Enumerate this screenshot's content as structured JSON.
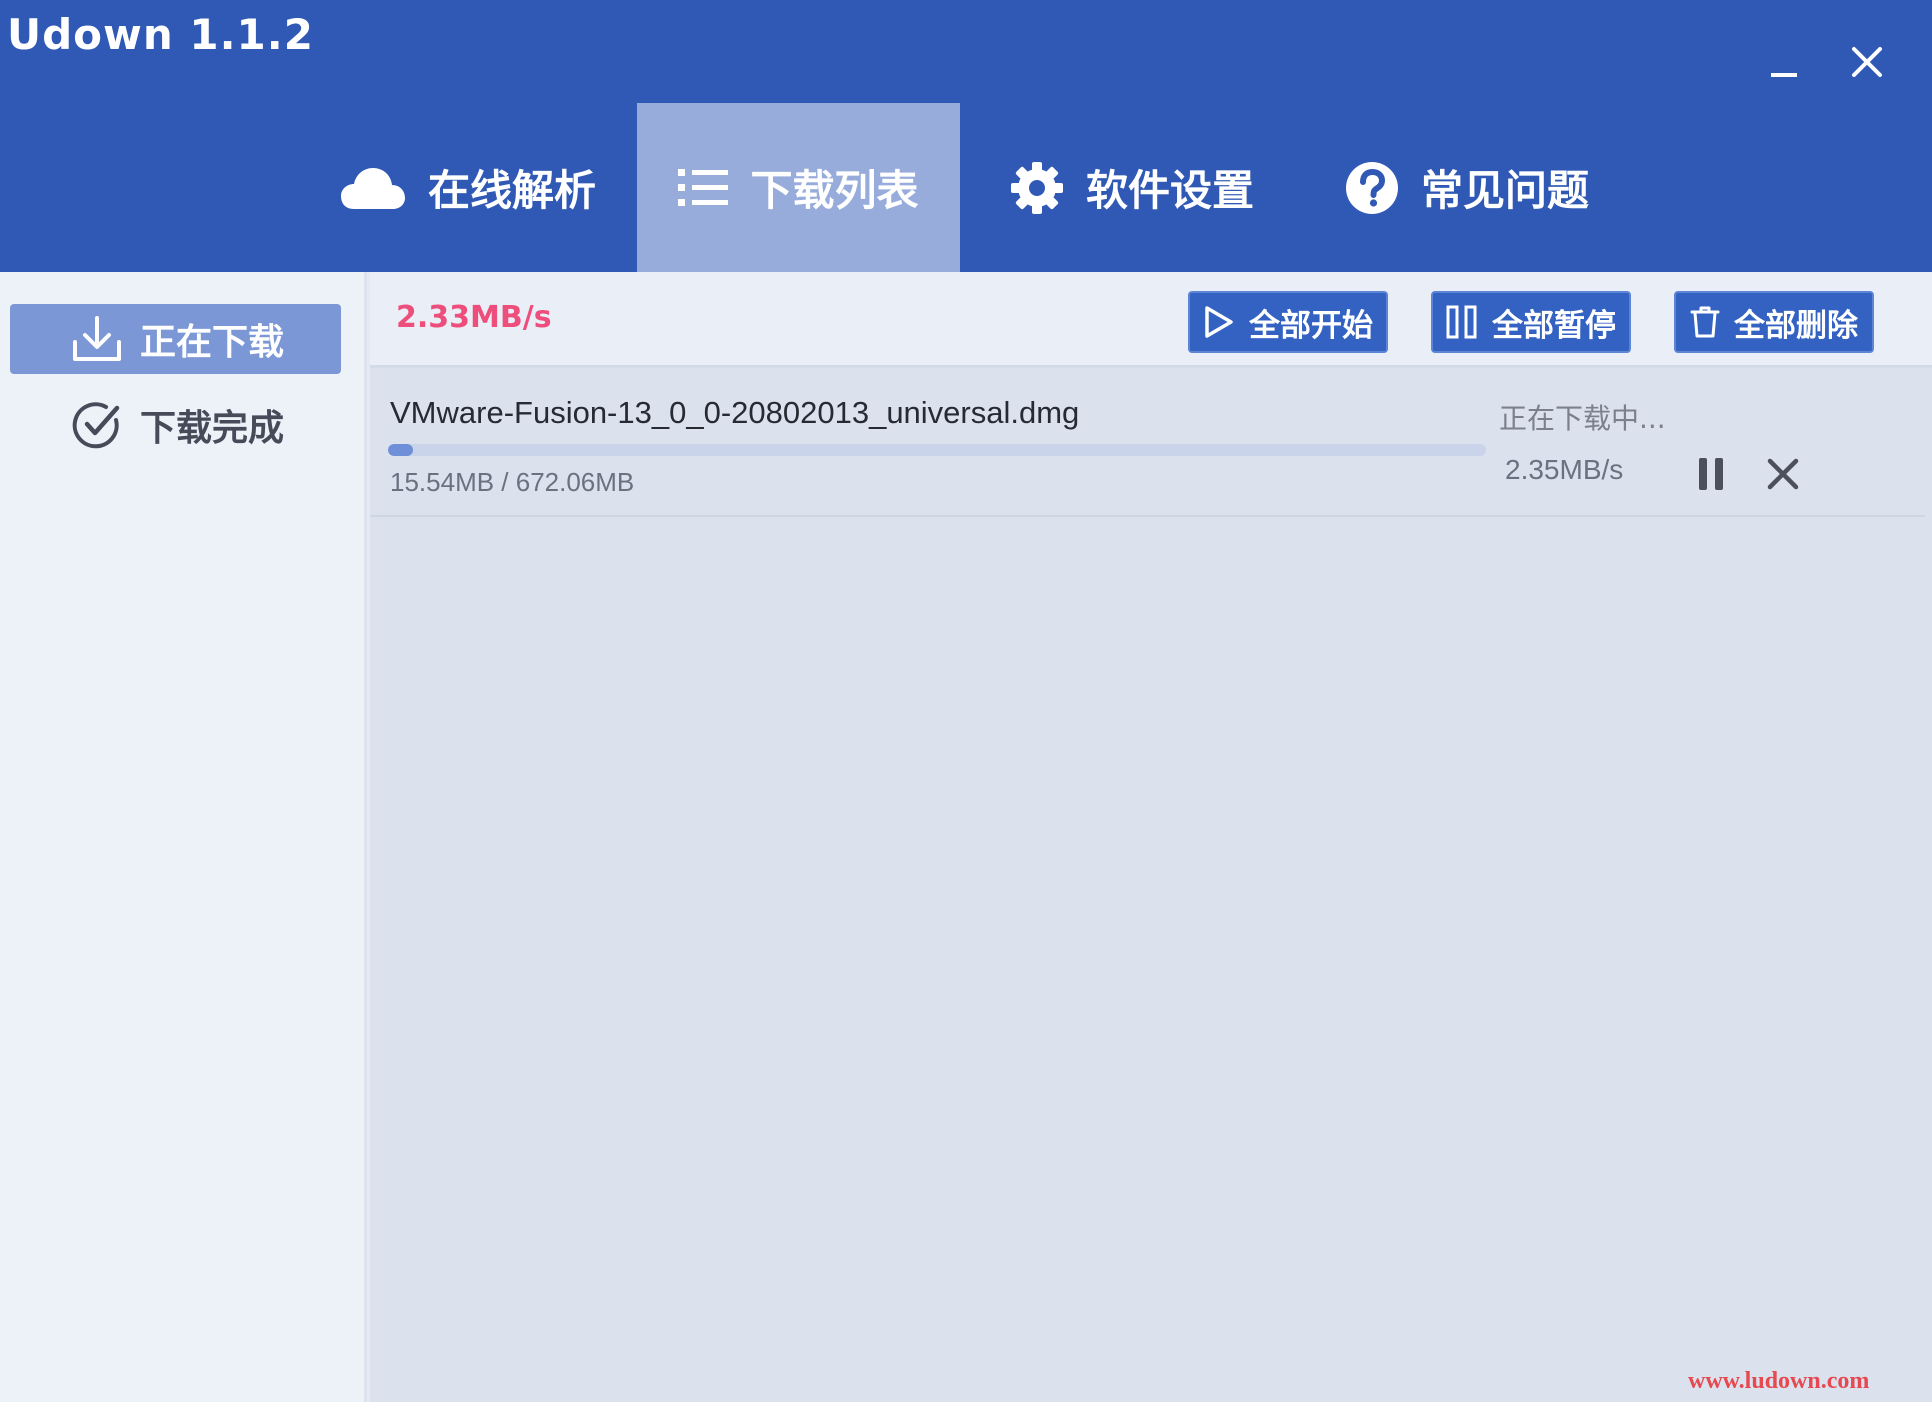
{
  "app": {
    "title": "Udown 1.1.2"
  },
  "window_controls": {
    "minimize_icon": "minimize-icon",
    "close_icon": "close-icon"
  },
  "nav": {
    "tabs": [
      {
        "label": "在线解析",
        "icon": "cloud-icon",
        "active": false
      },
      {
        "label": "下载列表",
        "icon": "list-icon",
        "active": true
      },
      {
        "label": "软件设置",
        "icon": "gear-icon",
        "active": false
      },
      {
        "label": "常见问题",
        "icon": "question-icon",
        "active": false
      }
    ]
  },
  "sidebar": {
    "items": [
      {
        "label": "正在下载",
        "icon": "download-icon",
        "active": true
      },
      {
        "label": "下载完成",
        "icon": "check-circle-icon",
        "active": false
      }
    ]
  },
  "toolbar": {
    "total_speed": "2.33MB/s",
    "start_all": "全部开始",
    "pause_all": "全部暂停",
    "delete_all": "全部删除"
  },
  "tasks": [
    {
      "name": "VMware-Fusion-13_0_0-20802013_universal.dmg",
      "size": "15.54MB / 672.06MB",
      "progress": 0.023,
      "status": "正在下载中...",
      "speed": "2.35MB/s"
    }
  ],
  "colors": {
    "brand": "#2f59b5",
    "active_tab": "#97acdb",
    "speed_accent": "#ee4e7c"
  },
  "watermark": "www.ludown.com"
}
